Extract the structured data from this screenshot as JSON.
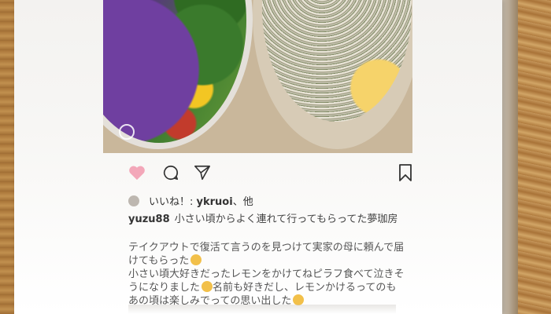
{
  "post": {
    "likes_prefix": "いいね！: ",
    "likes_user": "ykruoi",
    "likes_suffix": "、他",
    "username": "yuzu88",
    "caption_title": "小さい頃からよく連れて行ってもらってた夢珈房",
    "body_lines": [
      "テイクアウトで復活て言うのを見つけて実家の母に頼んで届",
      "けてもらった",
      "小さい頃大好きだったレモンをかけてねピラフ食べて泣きそ",
      "うになりました",
      "名前も好きだし、レモンかけるってのも",
      "あの頃は楽しみでっての思い出した"
    ]
  },
  "colors": {
    "like_heart": "#f3a7b9",
    "text": "#444444"
  },
  "icons": [
    "heart-icon",
    "comment-icon",
    "share-icon",
    "bookmark-icon"
  ]
}
